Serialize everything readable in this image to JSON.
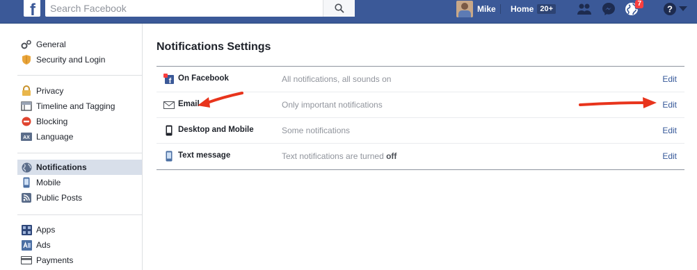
{
  "topbar": {
    "logo": "f",
    "search_placeholder": "Search Facebook",
    "user_name": "Mike",
    "home_label": "Home",
    "home_count": "20+",
    "notifications_badge": "7",
    "icons": [
      "search-icon",
      "friend-requests-icon",
      "messenger-icon",
      "globe-notifications-icon",
      "help-icon",
      "chevron-down-icon"
    ],
    "colors": {
      "bar": "#3b5998",
      "badge": "#fa3e3e"
    }
  },
  "sidebar": {
    "groups": [
      [
        {
          "label": "General",
          "icon": "gear-icon"
        },
        {
          "label": "Security and Login",
          "icon": "shield-icon"
        }
      ],
      [
        {
          "label": "Privacy",
          "icon": "lock-icon"
        },
        {
          "label": "Timeline and Tagging",
          "icon": "timeline-icon"
        },
        {
          "label": "Blocking",
          "icon": "block-icon"
        },
        {
          "label": "Language",
          "icon": "language-icon"
        }
      ],
      [
        {
          "label": "Notifications",
          "icon": "globe-icon",
          "active": true
        },
        {
          "label": "Mobile",
          "icon": "mobile-icon"
        },
        {
          "label": "Public Posts",
          "icon": "rss-icon"
        }
      ],
      [
        {
          "label": "Apps",
          "icon": "apps-icon"
        },
        {
          "label": "Ads",
          "icon": "ads-icon"
        },
        {
          "label": "Payments",
          "icon": "payment-card-icon"
        }
      ]
    ],
    "active_color": "#d8dfea"
  },
  "main": {
    "title": "Notifications Settings",
    "rows": [
      {
        "label": "On Facebook",
        "description": "All notifications, all sounds on",
        "description_bold": "",
        "edit": "Edit",
        "icon": "facebook-notification-icon"
      },
      {
        "label": "Email",
        "description": "Only important notifications",
        "description_bold": "",
        "edit": "Edit",
        "icon": "envelope-icon"
      },
      {
        "label": "Desktop and Mobile",
        "description": "Some notifications",
        "description_bold": "",
        "edit": "Edit",
        "icon": "phone-icon"
      },
      {
        "label": "Text message",
        "description": "Text notifications are turned ",
        "description_bold": "off",
        "edit": "Edit",
        "icon": "sms-phone-icon"
      }
    ],
    "link_color": "#365899",
    "annotation_arrow_color": "#e8341c"
  }
}
